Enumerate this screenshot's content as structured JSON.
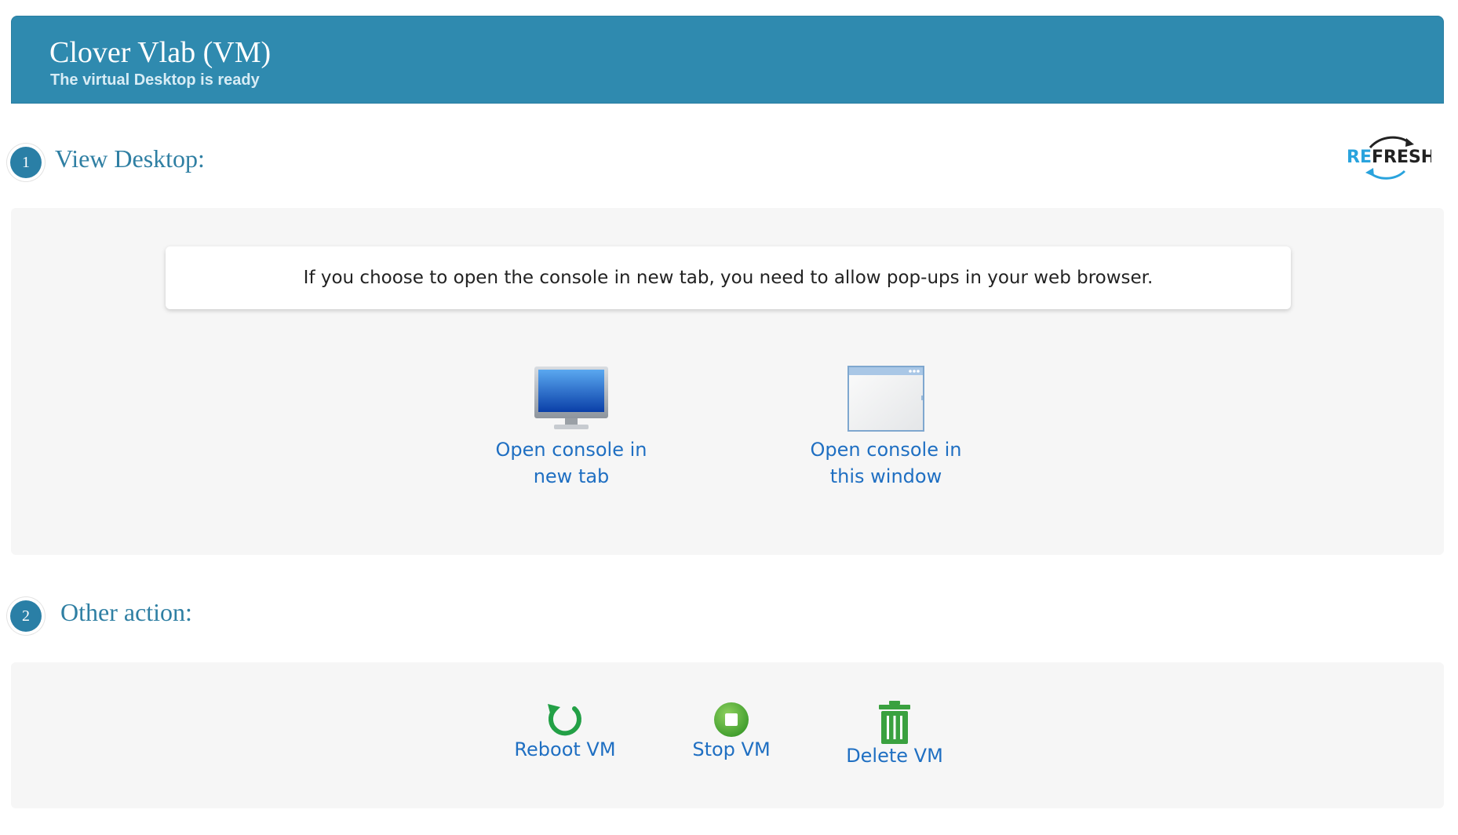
{
  "header": {
    "title": "Clover Vlab (VM)",
    "subtitle": "The virtual Desktop is ready"
  },
  "refresh": {
    "label_part1": "RE",
    "label_part2": "FRESH",
    "icon": "refresh-icon"
  },
  "steps": [
    {
      "number": "1",
      "title": "View Desktop:"
    },
    {
      "number": "2",
      "title": "Other action:"
    }
  ],
  "view_desktop": {
    "notice": "If you choose to open the console in new tab, you need to allow pop-ups in your web browser.",
    "actions": [
      {
        "label_line1": "Open console in",
        "label_line2": "new tab",
        "icon": "monitor-icon"
      },
      {
        "label_line1": "Open console in",
        "label_line2": "this window",
        "icon": "browser-window-icon"
      }
    ]
  },
  "other_actions": [
    {
      "label": "Reboot VM",
      "icon": "reboot-icon"
    },
    {
      "label": "Stop VM",
      "icon": "stop-icon"
    },
    {
      "label": "Delete VM",
      "icon": "trash-icon"
    }
  ],
  "colors": {
    "header_bg": "#2f8aaf",
    "step_circle": "#2a7fa6",
    "link": "#1f6fc2",
    "action_green": "#3aa13f",
    "panel_bg": "#f6f6f6"
  }
}
